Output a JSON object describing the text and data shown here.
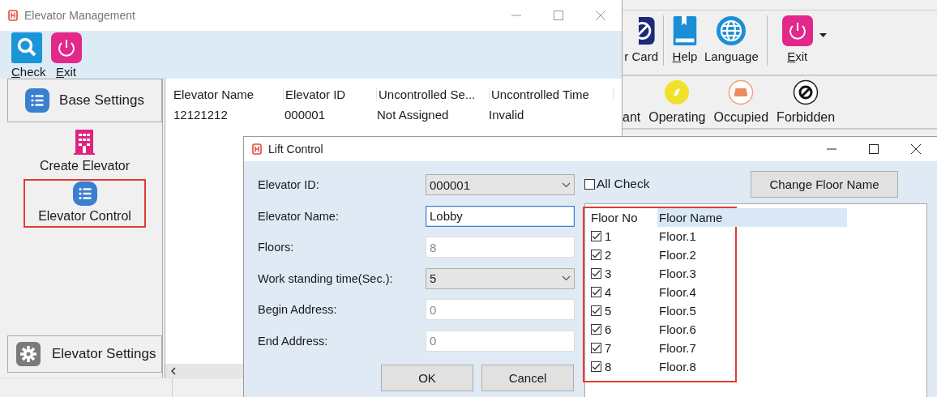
{
  "background_window": {
    "toolbar": [
      {
        "label": "r Card",
        "kind": "card"
      },
      {
        "label": "Help",
        "kind": "help"
      },
      {
        "label": "Language",
        "kind": "language"
      },
      {
        "label": "Exit",
        "kind": "exit"
      }
    ],
    "legend": [
      {
        "label": "ant",
        "kind": "hidden"
      },
      {
        "label": "Operating",
        "kind": "compass"
      },
      {
        "label": "Occupied",
        "kind": "bed"
      },
      {
        "label": "Forbidden",
        "kind": "forbidden"
      }
    ]
  },
  "manager_window": {
    "title": "Elevator Management",
    "toolbar": [
      {
        "label": "Check",
        "kind": "search"
      },
      {
        "label": "Exit",
        "kind": "exit"
      }
    ],
    "sidebar": {
      "header": "Base Settings",
      "items": [
        {
          "label": "Create Elevator",
          "kind": "building",
          "selected": false
        },
        {
          "label": "Elevator Control",
          "kind": "list",
          "selected": true
        }
      ],
      "footer": "Elevator Settings"
    },
    "table": {
      "columns": [
        "Elevator Name",
        "Elevator ID",
        "Uncontrolled Se...",
        "Uncontrolled Time"
      ],
      "rows": [
        [
          "12121212",
          "000001",
          "Not Assigned",
          "Invalid"
        ]
      ]
    }
  },
  "lift_dialog": {
    "title": "Lift Control",
    "fields": [
      {
        "label": "Elevator ID:",
        "kind": "dropdown",
        "value": "000001"
      },
      {
        "label": "Elevator Name:",
        "kind": "text",
        "value": "Lobby",
        "disabled": false,
        "focused": true
      },
      {
        "label": "Floors:",
        "kind": "text",
        "value": "8",
        "disabled": true,
        "focused": false
      },
      {
        "label": "Work standing time(Sec.):",
        "kind": "dropdown",
        "value": "5"
      },
      {
        "label": "Begin Address:",
        "kind": "text",
        "value": "0",
        "disabled": true,
        "focused": false
      },
      {
        "label": "End Address:",
        "kind": "text",
        "value": "0",
        "disabled": true,
        "focused": false
      }
    ],
    "buttons": [
      "OK",
      "Cancel"
    ],
    "all_check": {
      "label": "All Check",
      "checked": false
    },
    "change_button": "Change Floor Name",
    "floor_table": {
      "highlighted": true,
      "columns": [
        "Floor No",
        "Floor Name"
      ],
      "rows": [
        {
          "no": "1",
          "name": "Floor.1",
          "checked": true
        },
        {
          "no": "2",
          "name": "Floor.2",
          "checked": true
        },
        {
          "no": "3",
          "name": "Floor.3",
          "checked": true
        },
        {
          "no": "4",
          "name": "Floor.4",
          "checked": true
        },
        {
          "no": "5",
          "name": "Floor.5",
          "checked": true
        },
        {
          "no": "6",
          "name": "Floor.6",
          "checked": true
        },
        {
          "no": "7",
          "name": "Floor.7",
          "checked": true
        },
        {
          "no": "8",
          "name": "Floor.8",
          "checked": true
        }
      ]
    }
  }
}
